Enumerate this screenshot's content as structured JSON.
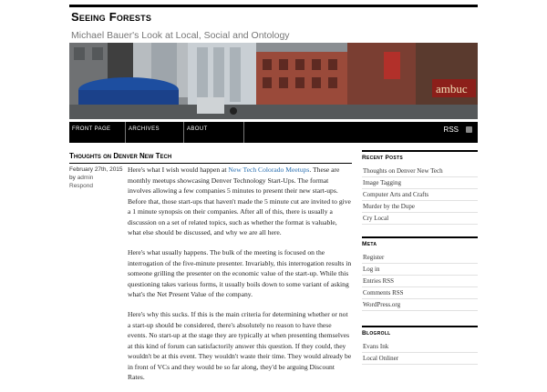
{
  "site": {
    "title": "Seeing Forests",
    "tagline": "Michael Bauer's Look at Local, Social and Ontology"
  },
  "banner": {
    "description_icon": "street-photo"
  },
  "nav": {
    "items": [
      {
        "label": "FRONT PAGE"
      },
      {
        "label": "ARCHIVES"
      },
      {
        "label": "ABOUT"
      }
    ],
    "rss_label": "RSS"
  },
  "post": {
    "title": "Thoughts on Denver New Tech",
    "date": "February 27th, 2015",
    "by": "by",
    "author": "admin",
    "respond": "Respond",
    "paragraphs": [
      {
        "before": "Here's what I wish would happen at ",
        "link": "New Tech Colorado Meetups",
        "after": ". These are monthly meetups showcasing Denver Technology Start-Ups. The format involves allowing a few companies 5 minutes to present their new start-ups. Before that, those start-ups that haven't made the 5 minute cut are invited to give a 1 minute synopsis on their companies. After all of this, there is usually a discussion on a set of related topics, such as whether the format is valuable, what else should be discussed, and why we are all here."
      },
      {
        "text": "Here's what usually happens. The bulk of the meeting is focused on the interrogation of the five-minute presenter. Invariably, this interrogation results in someone grilling the presenter on the economic value of the start-up. While this questioning takes various forms, it usually boils down to some variant of asking what's the Net Present Value of the company."
      },
      {
        "text": "Here's why this sucks. If this is the main criteria for determining whether or not a start-up should be considered, there's absolutely no reason to have these events. No start-up at the stage they are typically at when presenting themselves at this kind of forum can satisfactorily answer this question. If they could, they wouldn't be at this event. They wouldn't waste their time. They would already be in front of VCs and they would be so far along, they'd be arguing Discount Rates."
      }
    ]
  },
  "sidebar": {
    "recent_posts": {
      "heading": "Recent Posts",
      "items": [
        "Thoughts on Denver New Tech",
        "Image Tagging",
        "Computer Arts and Crafts",
        "Murder by the Dupe",
        "Cry Local"
      ]
    },
    "meta": {
      "heading": "Meta",
      "items": [
        "Register",
        "Log in",
        "Entries RSS",
        "Comments RSS",
        "WordPress.org"
      ]
    },
    "blogroll": {
      "heading": "Blogroll",
      "items": [
        "Evans Ink",
        "Local Onliner"
      ]
    }
  }
}
